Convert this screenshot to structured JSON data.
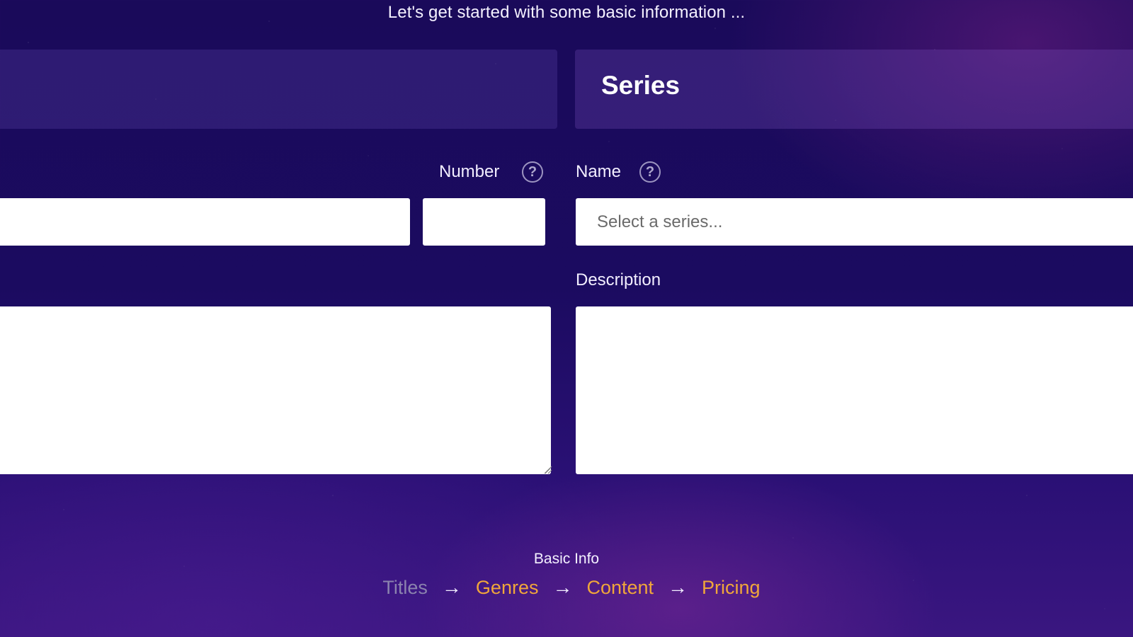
{
  "header": {
    "message": "Let's get started with some basic information ..."
  },
  "series_panel": {
    "title": "Series"
  },
  "fields": {
    "number_label": "Number",
    "name_label": "Name",
    "name_placeholder": "Select a series...",
    "description_label": "Description"
  },
  "icons": {
    "help": "question-circle-icon",
    "help_glyph": "?"
  },
  "wizard": {
    "current_step_name": "Basic Info",
    "steps": [
      {
        "label": "Titles",
        "state": "current"
      },
      {
        "label": "Genres",
        "state": "pending"
      },
      {
        "label": "Content",
        "state": "pending"
      },
      {
        "label": "Pricing",
        "state": "pending"
      }
    ],
    "arrow_glyph": "→"
  },
  "colors": {
    "step_pending": "#f0a63a",
    "step_current": "#8b83ae",
    "background_top": "#1a0a5a",
    "background_bottom": "#3a1680"
  }
}
